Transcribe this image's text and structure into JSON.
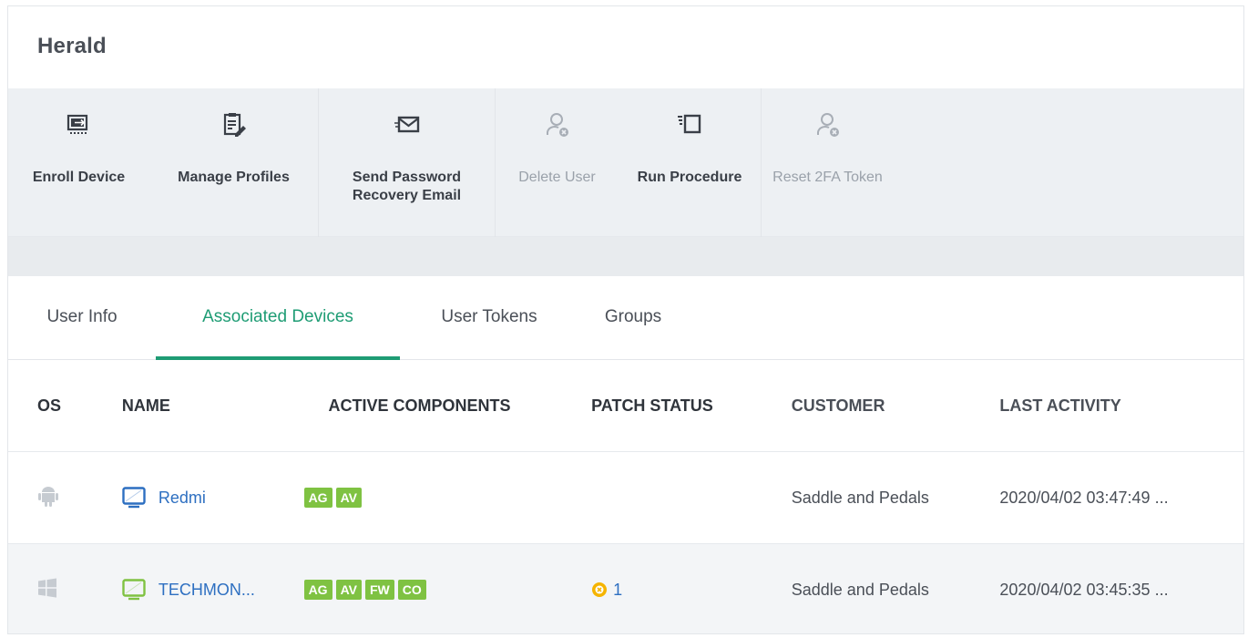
{
  "header": {
    "title": "Herald"
  },
  "toolbar": {
    "items": [
      {
        "label": "Enroll Device",
        "icon": "enroll-device-icon",
        "enabled": true
      },
      {
        "label": "Manage Profiles",
        "icon": "manage-profiles-icon",
        "enabled": true
      },
      {
        "label": "Send Password\nRecovery Email",
        "icon": "envelope-icon",
        "enabled": true
      },
      {
        "label": "Delete User",
        "icon": "delete-user-icon",
        "enabled": false
      },
      {
        "label": "Run Procedure",
        "icon": "run-procedure-icon",
        "enabled": true
      },
      {
        "label": "Reset 2FA Token",
        "icon": "reset-token-icon",
        "enabled": false
      }
    ]
  },
  "tabs": {
    "items": [
      {
        "label": "User Info",
        "active": false
      },
      {
        "label": "Associated Devices",
        "active": true
      },
      {
        "label": "User Tokens",
        "active": false
      },
      {
        "label": "Groups",
        "active": false
      }
    ]
  },
  "table": {
    "headers": {
      "os": "OS",
      "name": "NAME",
      "components": "ACTIVE COMPONENTS",
      "patch": "PATCH STATUS",
      "customer": "CUSTOMER",
      "last": "LAST ACTIVITY"
    },
    "rows": [
      {
        "os_icon": "android-icon",
        "device_icon": "monitor-icon",
        "device_color": "#2d6fc1",
        "name": "Redmi",
        "components": [
          "AG",
          "AV"
        ],
        "patch": "",
        "customer": "Saddle and Pedals",
        "last": "2020/04/02 03:47:49 ..."
      },
      {
        "os_icon": "windows-icon",
        "device_icon": "monitor-icon",
        "device_color": "#7fc242",
        "name": "TECHMON...",
        "components": [
          "AG",
          "AV",
          "FW",
          "CO"
        ],
        "patch": "1",
        "customer": "Saddle and Pedals",
        "last": "2020/04/02 03:45:35 ..."
      }
    ]
  },
  "colors": {
    "accent": "#1e9c74",
    "link": "#2d6fc1",
    "badge": "#7fc242",
    "warning": "#f5b400"
  }
}
